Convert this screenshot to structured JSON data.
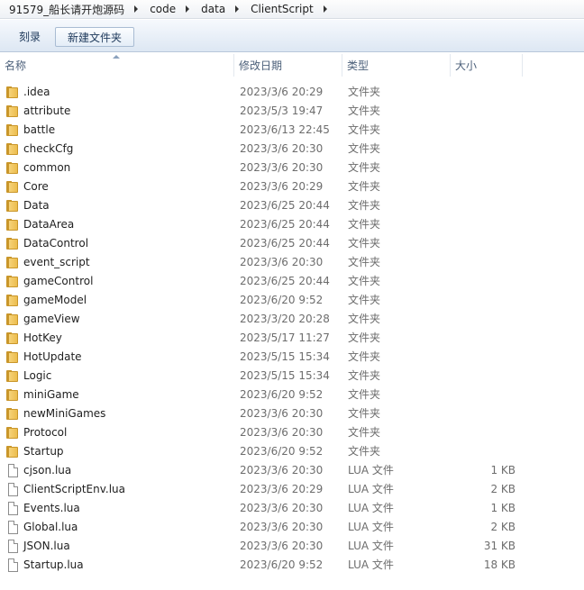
{
  "breadcrumb": [
    "91579_船长请开炮源码",
    "code",
    "data",
    "ClientScript"
  ],
  "toolbar": {
    "burn_label": "刻录",
    "new_folder_label": "新建文件夹"
  },
  "columns": {
    "name": "名称",
    "date": "修改日期",
    "type": "类型",
    "size": "大小"
  },
  "items": [
    {
      "name": ".idea",
      "date": "2023/3/6 20:29",
      "type": "文件夹",
      "size": "",
      "icon": "folder-icon"
    },
    {
      "name": "attribute",
      "date": "2023/5/3 19:47",
      "type": "文件夹",
      "size": "",
      "icon": "folder-icon"
    },
    {
      "name": "battle",
      "date": "2023/6/13 22:45",
      "type": "文件夹",
      "size": "",
      "icon": "folder-icon"
    },
    {
      "name": "checkCfg",
      "date": "2023/3/6 20:30",
      "type": "文件夹",
      "size": "",
      "icon": "folder-icon"
    },
    {
      "name": "common",
      "date": "2023/3/6 20:30",
      "type": "文件夹",
      "size": "",
      "icon": "folder-icon"
    },
    {
      "name": "Core",
      "date": "2023/3/6 20:29",
      "type": "文件夹",
      "size": "",
      "icon": "folder-icon"
    },
    {
      "name": "Data",
      "date": "2023/6/25 20:44",
      "type": "文件夹",
      "size": "",
      "icon": "folder-icon"
    },
    {
      "name": "DataArea",
      "date": "2023/6/25 20:44",
      "type": "文件夹",
      "size": "",
      "icon": "folder-icon"
    },
    {
      "name": "DataControl",
      "date": "2023/6/25 20:44",
      "type": "文件夹",
      "size": "",
      "icon": "folder-icon"
    },
    {
      "name": "event_script",
      "date": "2023/3/6 20:30",
      "type": "文件夹",
      "size": "",
      "icon": "folder-icon"
    },
    {
      "name": "gameControl",
      "date": "2023/6/25 20:44",
      "type": "文件夹",
      "size": "",
      "icon": "folder-icon"
    },
    {
      "name": "gameModel",
      "date": "2023/6/20 9:52",
      "type": "文件夹",
      "size": "",
      "icon": "folder-icon"
    },
    {
      "name": "gameView",
      "date": "2023/3/20 20:28",
      "type": "文件夹",
      "size": "",
      "icon": "folder-icon"
    },
    {
      "name": "HotKey",
      "date": "2023/5/17 11:27",
      "type": "文件夹",
      "size": "",
      "icon": "folder-icon"
    },
    {
      "name": "HotUpdate",
      "date": "2023/5/15 15:34",
      "type": "文件夹",
      "size": "",
      "icon": "folder-icon"
    },
    {
      "name": "Logic",
      "date": "2023/5/15 15:34",
      "type": "文件夹",
      "size": "",
      "icon": "folder-icon"
    },
    {
      "name": "miniGame",
      "date": "2023/6/20 9:52",
      "type": "文件夹",
      "size": "",
      "icon": "folder-icon"
    },
    {
      "name": "newMiniGames",
      "date": "2023/3/6 20:30",
      "type": "文件夹",
      "size": "",
      "icon": "folder-icon"
    },
    {
      "name": "Protocol",
      "date": "2023/3/6 20:30",
      "type": "文件夹",
      "size": "",
      "icon": "folder-icon"
    },
    {
      "name": "Startup",
      "date": "2023/6/20 9:52",
      "type": "文件夹",
      "size": "",
      "icon": "folder-icon"
    },
    {
      "name": "cjson.lua",
      "date": "2023/3/6 20:30",
      "type": "LUA 文件",
      "size": "1 KB",
      "icon": "file-icon"
    },
    {
      "name": "ClientScriptEnv.lua",
      "date": "2023/3/6 20:29",
      "type": "LUA 文件",
      "size": "2 KB",
      "icon": "file-icon"
    },
    {
      "name": "Events.lua",
      "date": "2023/3/6 20:30",
      "type": "LUA 文件",
      "size": "1 KB",
      "icon": "file-icon"
    },
    {
      "name": "Global.lua",
      "date": "2023/3/6 20:30",
      "type": "LUA 文件",
      "size": "2 KB",
      "icon": "file-icon"
    },
    {
      "name": "JSON.lua",
      "date": "2023/3/6 20:30",
      "type": "LUA 文件",
      "size": "31 KB",
      "icon": "file-icon"
    },
    {
      "name": "Startup.lua",
      "date": "2023/6/20 9:52",
      "type": "LUA 文件",
      "size": "18 KB",
      "icon": "file-icon"
    }
  ]
}
